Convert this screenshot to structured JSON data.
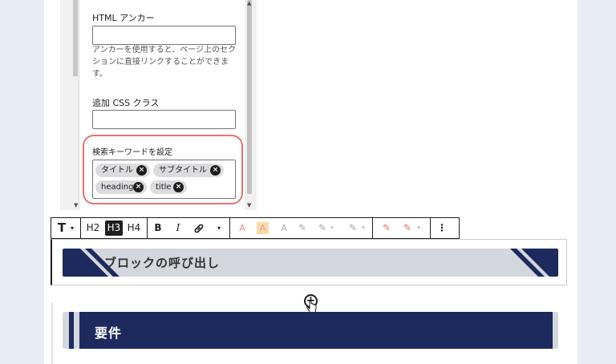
{
  "sidebar": {
    "anchor_label": "HTML アンカー",
    "anchor_value": "",
    "anchor_help": "アンカーを使用すると、ページ上のセクションに直接リンクすることができます。",
    "css_label": "追加 CSS クラス",
    "css_value": "",
    "keywords_label": "検索キーワードを設定",
    "tags": [
      "タイトル",
      "サブタイトル",
      "heading",
      "title"
    ]
  },
  "toolbar": {
    "text_type": "T",
    "h2": "H2",
    "h3": "H3",
    "h4": "H4",
    "bold": "B",
    "italic": "I",
    "caret": "▾"
  },
  "block1": {
    "text": "ブロックの呼び出し"
  },
  "block2": {
    "text": "要件"
  },
  "colors": {
    "navy": "#1c2a5e",
    "highlight": "#e57373"
  }
}
